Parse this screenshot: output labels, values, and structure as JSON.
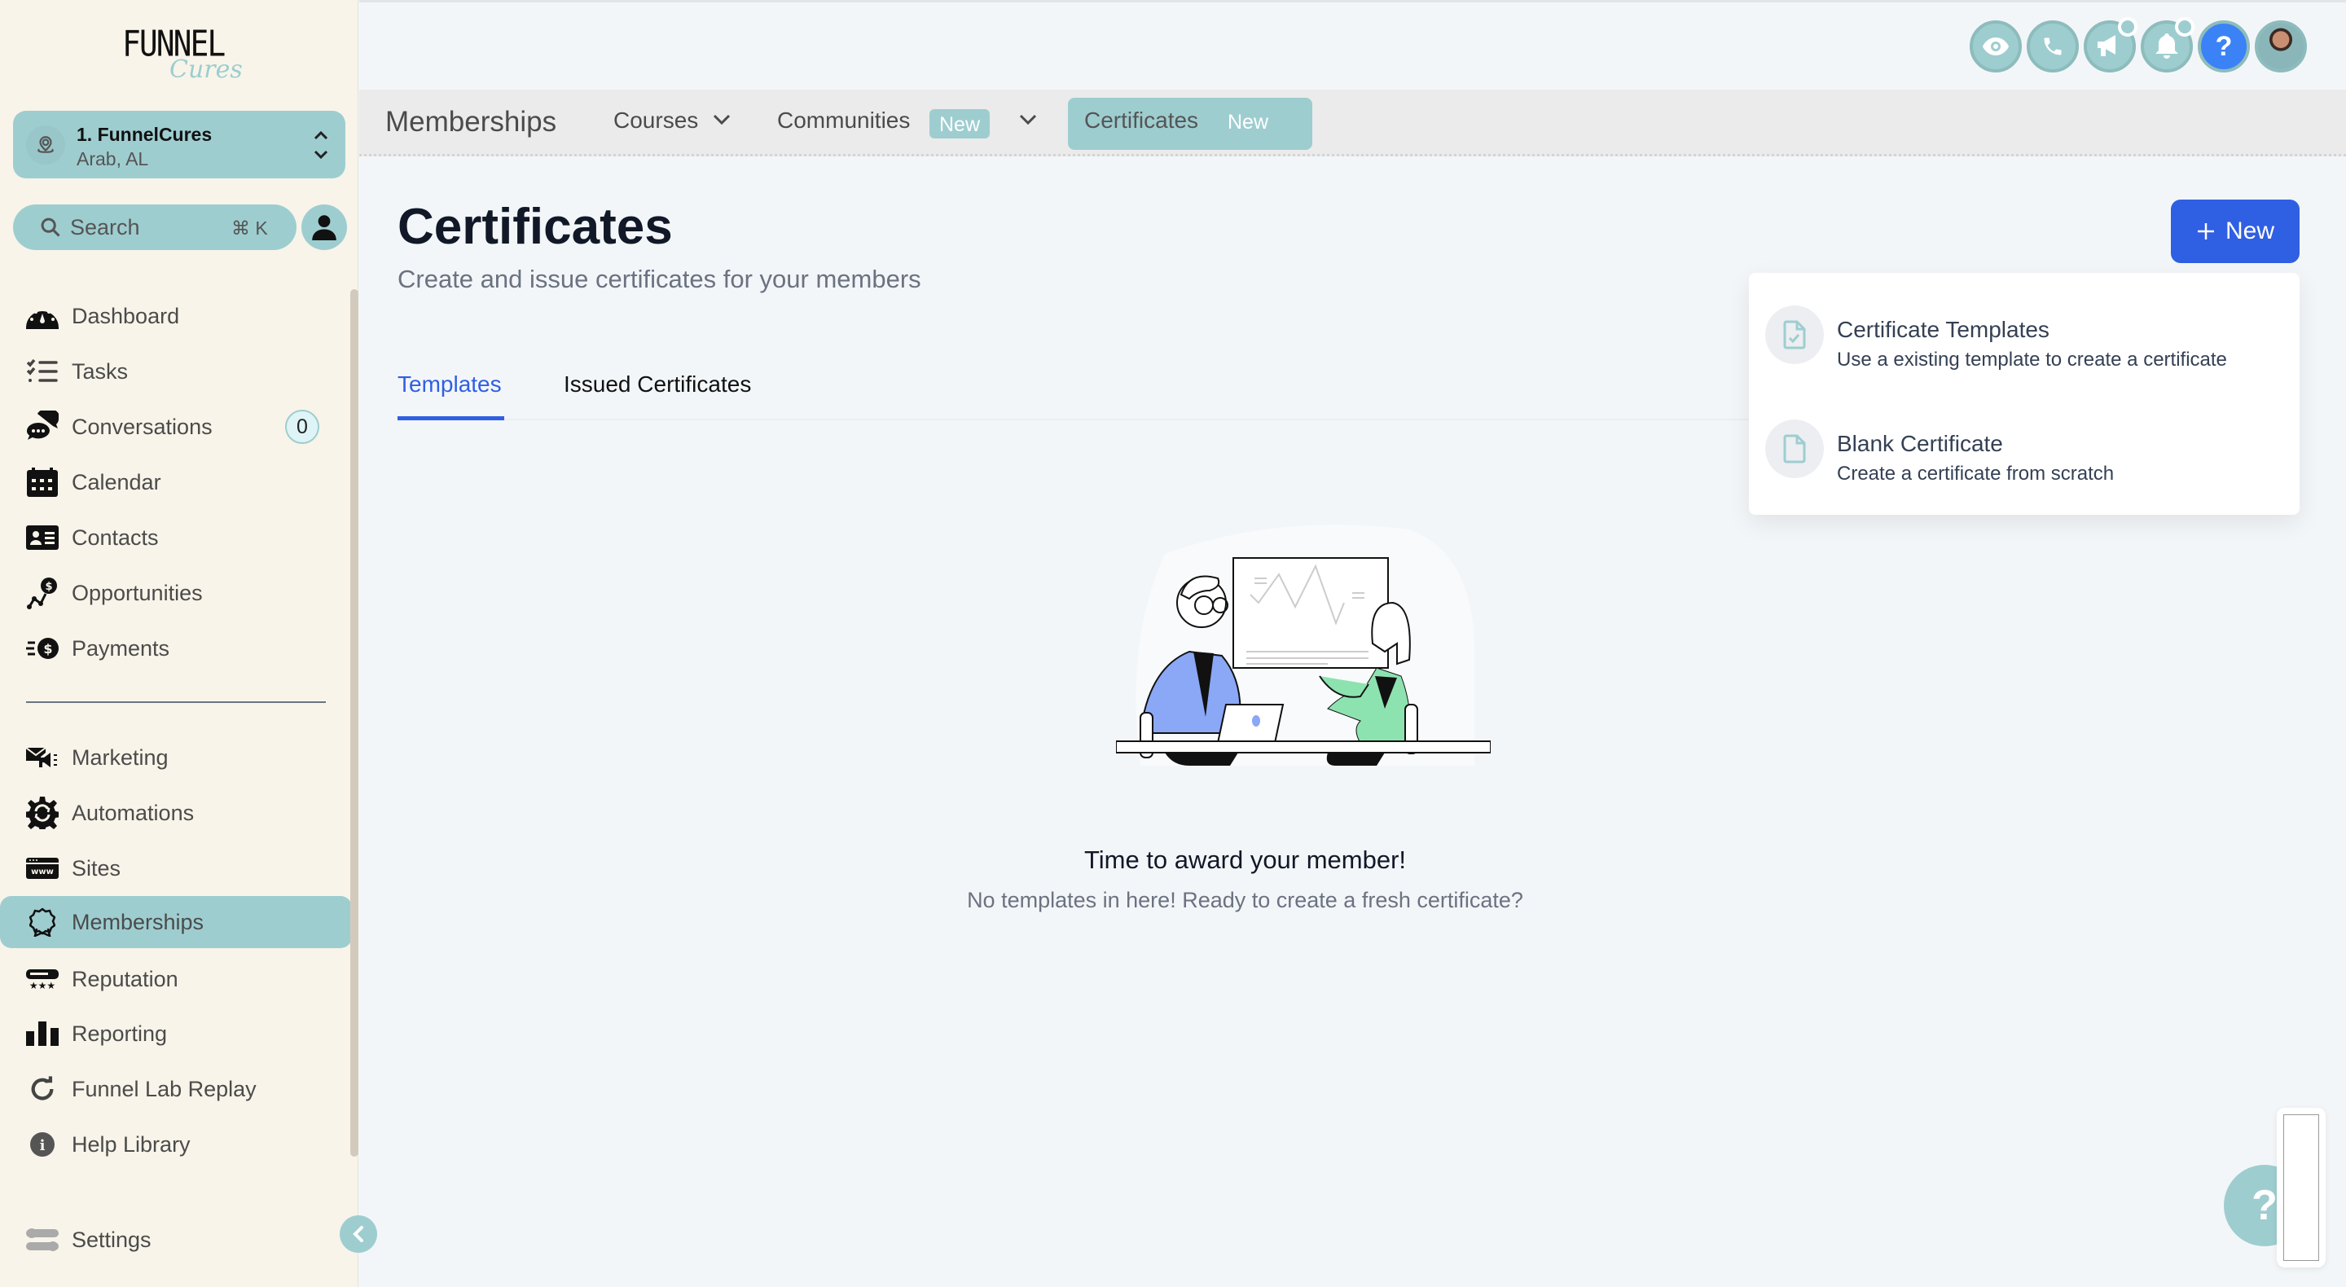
{
  "brand": {
    "line1": "FUNNEL",
    "line2": "Cures"
  },
  "location": {
    "name": "1. FunnelCures",
    "sub": "Arab, AL"
  },
  "search": {
    "placeholder": "Search",
    "shortcut": "⌘ K"
  },
  "sidebar": {
    "items": [
      {
        "id": "dashboard",
        "label": "Dashboard",
        "icon": "dashboard-gauge-icon"
      },
      {
        "id": "tasks",
        "label": "Tasks",
        "icon": "task-list-icon"
      },
      {
        "id": "conversations",
        "label": "Conversations",
        "icon": "chat-bubbles-icon",
        "badge": "0"
      },
      {
        "id": "calendar",
        "label": "Calendar",
        "icon": "calendar-icon"
      },
      {
        "id": "contacts",
        "label": "Contacts",
        "icon": "contact-card-icon"
      },
      {
        "id": "opportunities",
        "label": "Opportunities",
        "icon": "opportunities-icon"
      },
      {
        "id": "payments",
        "label": "Payments",
        "icon": "payments-icon"
      },
      {
        "id": "marketing",
        "label": "Marketing",
        "icon": "marketing-megaphone-icon"
      },
      {
        "id": "automations",
        "label": "Automations",
        "icon": "automation-gear-icon"
      },
      {
        "id": "sites",
        "label": "Sites",
        "icon": "website-icon"
      },
      {
        "id": "memberships",
        "label": "Memberships",
        "icon": "award-badge-icon",
        "active": true
      },
      {
        "id": "reputation",
        "label": "Reputation",
        "icon": "reputation-stars-icon"
      },
      {
        "id": "reporting",
        "label": "Reporting",
        "icon": "bar-chart-icon"
      },
      {
        "id": "funnel-lab-replay",
        "label": "Funnel Lab Replay",
        "icon": "replay-icon"
      },
      {
        "id": "help-library",
        "label": "Help Library",
        "icon": "info-icon"
      },
      {
        "id": "settings",
        "label": "Settings",
        "icon": "settings-toggles-icon"
      }
    ]
  },
  "subnav": {
    "title": "Memberships",
    "courses": "Courses",
    "communities": "Communities",
    "communities_badge": "New",
    "certificates": "Certificates",
    "certificates_badge": "New"
  },
  "page": {
    "title": "Certificates",
    "subtitle": "Create and issue certificates for your members",
    "new_button": "New"
  },
  "tabs": [
    {
      "label": "Templates",
      "active": true
    },
    {
      "label": "Issued Certificates",
      "active": false
    }
  ],
  "dropdown": {
    "items": [
      {
        "title": "Certificate Templates",
        "desc": "Use a existing template to create a certificate"
      },
      {
        "title": "Blank Certificate",
        "desc": "Create a certificate from scratch"
      }
    ]
  },
  "empty": {
    "title": "Time to award your member!",
    "subtitle": "No templates in here! Ready to create a fresh certificate?"
  },
  "help_fab": "?",
  "colors": {
    "accent": "#9ecdd0",
    "primary": "#2f5fe3",
    "sidebar_bg": "#f8f4e9",
    "main_bg": "#f3f6f9"
  }
}
